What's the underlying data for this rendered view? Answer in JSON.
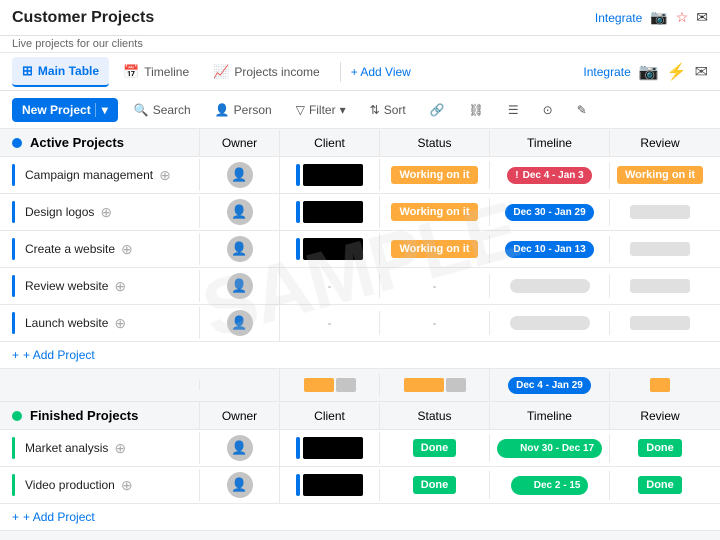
{
  "app": {
    "title": "Customer Projects",
    "subtitle": "Live projects for our clients"
  },
  "tabs": [
    {
      "id": "main-table",
      "label": "Main Table",
      "icon": "⊞",
      "active": true
    },
    {
      "id": "timeline",
      "label": "Timeline",
      "icon": "📅",
      "active": false
    },
    {
      "id": "projects-income",
      "label": "Projects income",
      "icon": "📈",
      "active": false
    }
  ],
  "add_view_label": "+ Add View",
  "integrate_label": "Integrate",
  "toolbar": {
    "new_project_label": "New Project",
    "search_label": "Search",
    "person_label": "Person",
    "filter_label": "Filter",
    "sort_label": "Sort"
  },
  "columns": {
    "owner": "Owner",
    "client": "Client",
    "status": "Status",
    "timeline": "Timeline",
    "review": "Review"
  },
  "active_section": {
    "label": "Active Projects",
    "rows": [
      {
        "name": "Campaign management",
        "status": "Working on it",
        "timeline": "Dec 4 - Jan 3",
        "timeline_color": "red",
        "review": "Working on it",
        "review_color": "orange",
        "has_client": true
      },
      {
        "name": "Design logos",
        "status": "Working on it",
        "timeline": "Dec 30 - Jan 29",
        "timeline_color": "blue",
        "review": "",
        "review_color": "",
        "has_client": true
      },
      {
        "name": "Create a website",
        "status": "Working on it",
        "timeline": "Dec 10 - Jan 13",
        "timeline_color": "blue",
        "review": "",
        "review_color": "",
        "has_client": true
      },
      {
        "name": "Review website",
        "status": "-",
        "timeline": "",
        "timeline_color": "",
        "review": "",
        "review_color": "",
        "has_client": false
      },
      {
        "name": "Launch website",
        "status": "-",
        "timeline": "",
        "timeline_color": "",
        "review": "",
        "review_color": "",
        "has_client": false
      }
    ],
    "add_project_label": "+ Add Project",
    "summary_timeline": "Dec 4 - Jan 29"
  },
  "finished_section": {
    "label": "Finished Projects",
    "rows": [
      {
        "name": "Market analysis",
        "status": "Done",
        "timeline": "Nov 30 - Dec 17",
        "timeline_color": "green",
        "review": "Done",
        "review_color": "green",
        "has_client": true
      },
      {
        "name": "Video production",
        "status": "Done",
        "timeline": "Dec 2 - 15",
        "timeline_color": "green",
        "review": "Done",
        "review_color": "green",
        "has_client": true
      }
    ],
    "add_project_label": "+ Add Project"
  },
  "watermark": "SAMPLE"
}
